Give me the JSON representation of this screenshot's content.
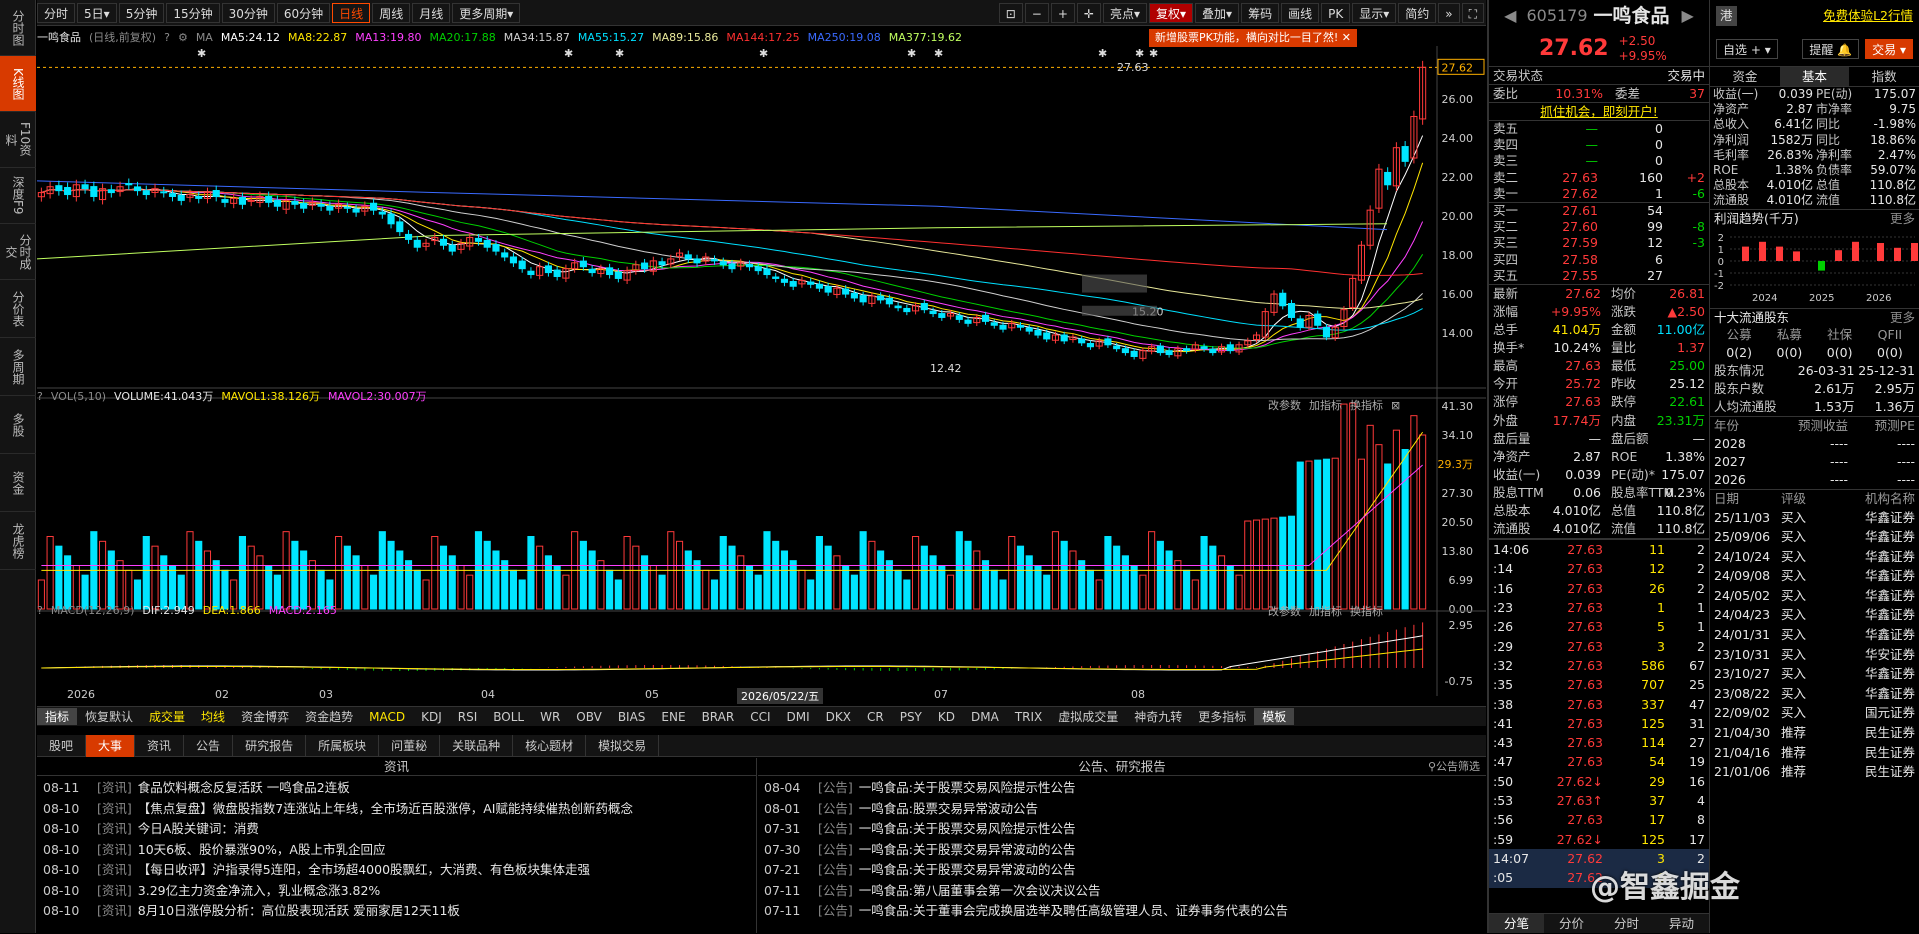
{
  "leftnav": [
    "分时图",
    "K线图",
    "F10资料",
    "深度F9",
    "分时成交",
    "分价表",
    "多周期",
    "多股",
    "资金",
    "龙虎榜"
  ],
  "toolbar": {
    "periods": [
      "分时",
      "5日▾",
      "5分钟",
      "15分钟",
      "30分钟",
      "60分钟",
      "日线",
      "周线",
      "月线",
      "更多周期▾"
    ],
    "tools": [
      "亮点▾",
      "复权▾",
      "叠加▾",
      "筹码",
      "画线",
      "PK",
      "显示▾",
      "简约"
    ]
  },
  "chart_header": {
    "name": "一鸣食品",
    "mode": "(日线,前复权)",
    "ma_label": "MA",
    "mas": [
      {
        "l": "MA5:24.12",
        "c": "#ffffff"
      },
      {
        "l": "MA8:22.87",
        "c": "#ffe600"
      },
      {
        "l": "MA13:19.80",
        "c": "#ff40ff"
      },
      {
        "l": "MA20:17.88",
        "c": "#00d000"
      },
      {
        "l": "MA34:15.87",
        "c": "#cfcfcf"
      },
      {
        "l": "MA55:15.27",
        "c": "#00e0ff"
      },
      {
        "l": "MA89:15.86",
        "c": "#e8e89a"
      },
      {
        "l": "MA144:17.25",
        "c": "#ff3030"
      },
      {
        "l": "MA250:19.08",
        "c": "#3a6aff"
      },
      {
        "l": "MA377:19.62",
        "c": "#c0ff60"
      }
    ]
  },
  "pk_tip": "新增股票PK功能，横向对比一目了然!",
  "price_labels": {
    "high": "27.63",
    "low": "12.42",
    "last": "27.62",
    "ma_mark": "15.20"
  },
  "price_axis": [
    "26.00",
    "24.00",
    "22.00",
    "20.00",
    "18.00",
    "16.00",
    "14.00"
  ],
  "vol_header": {
    "name": "VOL(5,10)",
    "v": "VOLUME:41.043万",
    "m1": "MAVOL1:38.126万",
    "m2": "MAVOL2:30.007万"
  },
  "vol_axis": [
    "41.30",
    "34.10",
    "29.3万",
    "27.30",
    "20.50",
    "13.80",
    "6.99",
    "0.00"
  ],
  "macd_header": {
    "name": "MACD(12,26,9)",
    "dif": "DIF:2.949",
    "dea": "DEA:1.866",
    "macd": "MACD:2.165"
  },
  "macd_axis": [
    "2.95",
    "-0.75"
  ],
  "panel_btns": [
    "改参数",
    "加指标",
    "换指标"
  ],
  "date_axis": [
    "2026",
    "02",
    "03",
    "04",
    "05",
    "2026/05/22/五",
    "07",
    "08"
  ],
  "indicators": [
    "指标",
    "恢复默认",
    "成交量",
    "均线",
    "资金博弈",
    "资金趋势",
    "MACD",
    "KDJ",
    "RSI",
    "BOLL",
    "WR",
    "OBV",
    "BIAS",
    "ENE",
    "BRAR",
    "CCI",
    "DMI",
    "DKX",
    "CR",
    "PSY",
    "KD",
    "DMA",
    "TRIX",
    "虚拟成交量",
    "神奇九转",
    "更多指标",
    "模板"
  ],
  "news_tabs": [
    "股吧",
    "大事",
    "资讯",
    "公告",
    "研究报告",
    "所属板块",
    "问董秘",
    "关联品种",
    "核心题材",
    "模拟交易"
  ],
  "news_left_title": "资讯",
  "news_right_title": "公告、研究报告",
  "news_filter": "公告筛选",
  "news_left": [
    {
      "d": "08-11",
      "t": "[资讯]",
      "x": "食品饮料概念反复活跃 一鸣食品2连板"
    },
    {
      "d": "08-10",
      "t": "[资讯]",
      "x": "【焦点复盘】微盘股指数7连涨站上年线，全市场近百股涨停，AI赋能持续催热创新药概念"
    },
    {
      "d": "08-10",
      "t": "[资讯]",
      "x": "今日A股关键词：消费"
    },
    {
      "d": "08-10",
      "t": "[资讯]",
      "x": "10天6板、股价暴涨90%，A股上市乳企回应"
    },
    {
      "d": "08-10",
      "t": "[资讯]",
      "x": "【每日收评】沪指录得5连阳，全市场超4000股飘红，大消费、有色板块集体走强"
    },
    {
      "d": "08-10",
      "t": "[资讯]",
      "x": "3.29亿主力资金净流入，乳业概念涨3.82%"
    },
    {
      "d": "08-10",
      "t": "[资讯]",
      "x": "8月10日涨停股分析：高位股表现活跃 爱丽家居12天11板"
    }
  ],
  "news_right": [
    {
      "d": "08-04",
      "t": "[公告]",
      "x": "一鸣食品:关于股票交易风险提示性公告"
    },
    {
      "d": "08-01",
      "t": "[公告]",
      "x": "一鸣食品:股票交易异常波动公告"
    },
    {
      "d": "07-31",
      "t": "[公告]",
      "x": "一鸣食品:关于股票交易风险提示性公告"
    },
    {
      "d": "07-30",
      "t": "[公告]",
      "x": "一鸣食品:关于股票交易异常波动的公告"
    },
    {
      "d": "07-21",
      "t": "[公告]",
      "x": "一鸣食品:关于股票交易异常波动的公告"
    },
    {
      "d": "07-11",
      "t": "[公告]",
      "x": "一鸣食品:第八届董事会第一次会议决议公告"
    },
    {
      "d": "07-11",
      "t": "[公告]",
      "x": "一鸣食品:关于董事会完成换届选举及聘任高级管理人员、证券事务代表的公告"
    }
  ],
  "quote": {
    "code": "605179",
    "name": "一鸣食品",
    "price": "27.62",
    "chg": "+2.50",
    "pct": "+9.95%",
    "hk": "港",
    "trial": "免费体验L2行情",
    "btn_zixuan": "自选",
    "btn_tixing": "提醒",
    "btn_jiaoyi": "交易",
    "status_label": "交易状态",
    "status": "交易中",
    "weibi_l": "委比",
    "weibi": "10.31%",
    "weicha_l": "委差",
    "weicha": "37",
    "promo": "抓住机会，即刻开户!"
  },
  "sells": [
    {
      "l": "卖五",
      "p": "—",
      "v": "0",
      "d": ""
    },
    {
      "l": "卖四",
      "p": "—",
      "v": "0",
      "d": ""
    },
    {
      "l": "卖三",
      "p": "—",
      "v": "0",
      "d": ""
    },
    {
      "l": "卖二",
      "p": "27.63",
      "v": "160",
      "d": "+2"
    },
    {
      "l": "卖一",
      "p": "27.62",
      "v": "1",
      "d": "-6"
    }
  ],
  "buys": [
    {
      "l": "买一",
      "p": "27.61",
      "v": "54",
      "d": ""
    },
    {
      "l": "买二",
      "p": "27.60",
      "v": "99",
      "d": "-8"
    },
    {
      "l": "买三",
      "p": "27.59",
      "v": "12",
      "d": "-3"
    },
    {
      "l": "买四",
      "p": "27.58",
      "v": "6",
      "d": ""
    },
    {
      "l": "买五",
      "p": "27.55",
      "v": "27",
      "d": ""
    }
  ],
  "stats": [
    [
      "最新",
      "27.62",
      "r",
      "均价",
      "26.81",
      "r"
    ],
    [
      "涨幅",
      "+9.95%",
      "r",
      "涨跌",
      "▲2.50",
      "r"
    ],
    [
      "总手",
      "41.04万",
      "y",
      "金额",
      "11.00亿",
      "c"
    ],
    [
      "换手*",
      "10.24%",
      "w",
      "量比",
      "1.37",
      "r"
    ],
    [
      "最高",
      "27.63",
      "r",
      "最低",
      "25.00",
      "g"
    ],
    [
      "今开",
      "25.72",
      "r",
      "昨收",
      "25.12",
      "w"
    ],
    [
      "涨停",
      "27.63",
      "r",
      "跌停",
      "22.61",
      "g"
    ],
    [
      "外盘",
      "17.74万",
      "r",
      "内盘",
      "23.31万",
      "g"
    ],
    [
      "盘后量",
      "—",
      "w",
      "盘后额",
      "—",
      "w"
    ],
    [
      "净资产",
      "2.87",
      "w",
      "ROE",
      "1.38%",
      "w"
    ],
    [
      "收益(一)",
      "0.039",
      "w",
      "PE(动)*",
      "175.07",
      "w"
    ],
    [
      "股息TTM",
      "0.06",
      "w",
      "股息率TTM",
      "0.23%",
      "w"
    ],
    [
      "总股本",
      "4.010亿",
      "w",
      "总值",
      "110.8亿",
      "w"
    ],
    [
      "流通股",
      "4.010亿",
      "w",
      "流值",
      "110.8亿",
      "w"
    ]
  ],
  "ticks": [
    [
      "14:06",
      "27.63",
      "11",
      "2"
    ],
    [
      ":14",
      "27.63",
      "12",
      "2"
    ],
    [
      ":16",
      "27.63",
      "26",
      "2"
    ],
    [
      ":23",
      "27.63",
      "1",
      "1"
    ],
    [
      ":26",
      "27.63",
      "5",
      "1"
    ],
    [
      ":29",
      "27.63",
      "3",
      "2"
    ],
    [
      ":32",
      "27.63",
      "586",
      "67"
    ],
    [
      ":35",
      "27.63",
      "707",
      "25"
    ],
    [
      ":38",
      "27.63",
      "337",
      "47"
    ],
    [
      ":41",
      "27.63",
      "125",
      "31"
    ],
    [
      ":43",
      "27.63",
      "114",
      "27"
    ],
    [
      ":47",
      "27.63",
      "54",
      "19"
    ],
    [
      ":50",
      "27.62↓",
      "29",
      "16"
    ],
    [
      ":53",
      "27.63↑",
      "37",
      "4"
    ],
    [
      ":56",
      "27.63",
      "17",
      "8"
    ],
    [
      ":59",
      "27.62↓",
      "125",
      "17"
    ],
    [
      "14:07",
      "27.62",
      "3",
      "2"
    ],
    [
      ":05",
      "27.62",
      "6",
      "1"
    ]
  ],
  "bottom_tabs": [
    "分笔",
    "分价",
    "分时",
    "异动"
  ],
  "f10_tabs": [
    "资金",
    "基本",
    "指数"
  ],
  "fund": [
    [
      "收益(一)",
      "0.039",
      "PE(动)",
      "175.07"
    ],
    [
      "净资产",
      "2.87",
      "市净率",
      "9.75"
    ],
    [
      "总收入",
      "6.41亿",
      "同比",
      "-1.98%"
    ],
    [
      "净利润",
      "1582万",
      "同比",
      "18.86%"
    ],
    [
      "毛利率",
      "26.83%",
      "净利率",
      "2.47%"
    ],
    [
      "ROE",
      "1.38%",
      "负债率",
      "59.07%"
    ],
    [
      "总股本",
      "4.010亿",
      "总值",
      "110.8亿"
    ],
    [
      "流通股",
      "4.010亿",
      "流值",
      "110.8亿"
    ]
  ],
  "profit_title": "利润趋势(千万)",
  "more": "更多",
  "profit_axis": [
    "2",
    "1",
    "0",
    "-1",
    "-2"
  ],
  "profit_years": [
    "2024",
    "2025",
    "2026"
  ],
  "profit_bars": [
    1.2,
    1.6,
    1.2,
    0.8,
    -0.8,
    0.9,
    1.6,
    1.5,
    1.1,
    1.5
  ],
  "holders_title": "十大流通股东",
  "holders_hdr": [
    "公募",
    "私募",
    "社保",
    "QFII"
  ],
  "holders_vals": [
    "0(2)",
    "0(0)",
    "0(0)",
    "0(0)"
  ],
  "holders_rows": [
    [
      "股东情况",
      "26-03-31",
      "25-12-31"
    ],
    [
      "股东户数",
      "2.61万",
      "2.95万"
    ],
    [
      "人均流通股",
      "1.53万",
      "1.36万"
    ]
  ],
  "forecast_hdr": [
    "年份",
    "预测收益",
    "预测PE"
  ],
  "forecast": [
    [
      "2028",
      "----",
      "----"
    ],
    [
      "2027",
      "----",
      "----"
    ],
    [
      "2026",
      "----",
      "----"
    ]
  ],
  "rating_hdr": [
    "日期",
    "评级",
    "机构名称"
  ],
  "ratings": [
    [
      "25/11/03",
      "买入",
      "华鑫证券"
    ],
    [
      "25/09/06",
      "买入",
      "华鑫证券"
    ],
    [
      "24/10/24",
      "买入",
      "华鑫证券"
    ],
    [
      "24/09/08",
      "买入",
      "华鑫证券"
    ],
    [
      "24/05/02",
      "买入",
      "华鑫证券"
    ],
    [
      "24/04/23",
      "买入",
      "华鑫证券"
    ],
    [
      "24/01/31",
      "买入",
      "华鑫证券"
    ],
    [
      "23/10/31",
      "买入",
      "华安证券"
    ],
    [
      "23/10/27",
      "买入",
      "华鑫证券"
    ],
    [
      "23/08/22",
      "买入",
      "华鑫证券"
    ],
    [
      "22/09/02",
      "买入",
      "国元证券"
    ],
    [
      "21/04/30",
      "推荐",
      "民生证券"
    ],
    [
      "21/04/16",
      "推荐",
      "民生证券"
    ],
    [
      "21/01/06",
      "推荐",
      "民生证券"
    ]
  ],
  "watermark": "@智鑫掘金",
  "chart_data": {
    "type": "candlestick",
    "title": "一鸣食品 (日线,前复权)",
    "close": [
      21.2,
      21.5,
      21.3,
      21.1,
      21.6,
      21.4,
      21.0,
      21.4,
      21.2,
      21.5,
      21.6,
      21.3,
      21.1,
      21.4,
      21.2,
      21.0,
      20.8,
      21.1,
      20.9,
      21.2,
      21.0,
      20.7,
      20.9,
      20.6,
      20.8,
      21.0,
      20.7,
      20.5,
      20.8,
      20.6,
      20.4,
      20.7,
      20.5,
      20.3,
      20.6,
      20.4,
      20.2,
      20.5,
      20.3,
      20.1,
      19.6,
      19.2,
      18.8,
      18.4,
      18.6,
      18.9,
      18.5,
      18.2,
      18.6,
      18.9,
      18.7,
      18.4,
      18.2,
      17.9,
      17.6,
      17.3,
      17.0,
      17.4,
      17.1,
      16.9,
      17.3,
      17.6,
      17.4,
      17.1,
      17.3,
      17.0,
      16.8,
      17.2,
      17.5,
      17.3,
      17.7,
      17.5,
      17.8,
      18.1,
      17.8,
      17.6,
      17.9,
      17.7,
      17.5,
      17.3,
      17.6,
      17.4,
      17.2,
      17.0,
      16.8,
      16.6,
      16.4,
      16.7,
      16.5,
      16.3,
      16.1,
      16.3,
      16.0,
      15.8,
      15.6,
      15.9,
      15.7,
      15.5,
      15.3,
      15.1,
      15.4,
      15.2,
      15.0,
      14.8,
      15.0,
      14.7,
      14.5,
      14.8,
      14.6,
      14.4,
      14.2,
      14.5,
      14.3,
      14.1,
      13.9,
      13.7,
      13.9,
      13.6,
      13.8,
      13.5,
      13.3,
      13.6,
      13.4,
      13.2,
      13.0,
      12.8,
      13.1,
      13.3,
      13.0,
      12.9,
      13.2,
      13.1,
      13.4,
      13.2,
      13.0,
      13.3,
      13.1,
      13.4,
      13.6,
      13.9,
      15.1,
      16.0,
      15.4,
      14.8,
      14.3,
      14.9,
      14.4,
      13.8,
      14.3,
      15.2,
      16.8,
      18.5,
      20.3,
      22.4,
      21.6,
      23.5,
      22.8,
      25.1,
      27.62
    ],
    "high": "27.63",
    "low": "12.42",
    "yaxis": [
      14,
      16,
      18,
      20,
      22,
      24,
      26
    ],
    "volume": {
      "last": "41.043万",
      "mavol1": "38.126万",
      "mavol2": "30.007万"
    },
    "macd": {
      "dif": 2.949,
      "dea": 1.866,
      "macd": 2.165
    }
  }
}
